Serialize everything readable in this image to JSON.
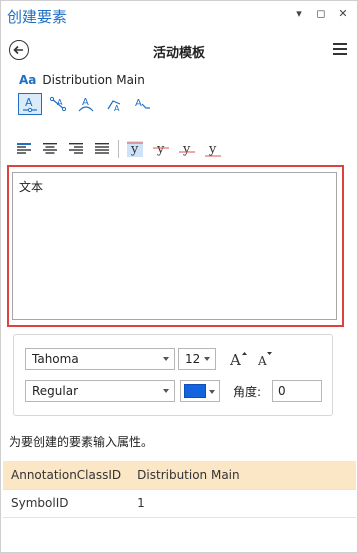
{
  "window": {
    "title": "创建要素",
    "controls": [
      "▾",
      "◻",
      "✕"
    ]
  },
  "header": {
    "title": "活动模板"
  },
  "template": {
    "icon_text": "Aa",
    "name": "Distribution Main"
  },
  "construction_tools": [
    {
      "name": "horizontal",
      "active": true
    },
    {
      "name": "straight"
    },
    {
      "name": "curved"
    },
    {
      "name": "follow-feature"
    },
    {
      "name": "leader-line"
    }
  ],
  "formatting": {
    "align": [
      "left",
      "center",
      "right",
      "justify"
    ],
    "vertical": [
      "top",
      "middle",
      "baseline",
      "bottom"
    ]
  },
  "text_area": {
    "value": "文本"
  },
  "font": {
    "family": "Tahoma",
    "size": "12",
    "style": "Regular",
    "color": "#1464e0",
    "angle_label": "角度:",
    "angle_value": "0"
  },
  "hint": "为要创建的要素输入属性。",
  "attributes": [
    {
      "key": "AnnotationClassID",
      "value": "Distribution Main",
      "selected": true
    },
    {
      "key": "SymbolID",
      "value": "1",
      "selected": false
    }
  ]
}
